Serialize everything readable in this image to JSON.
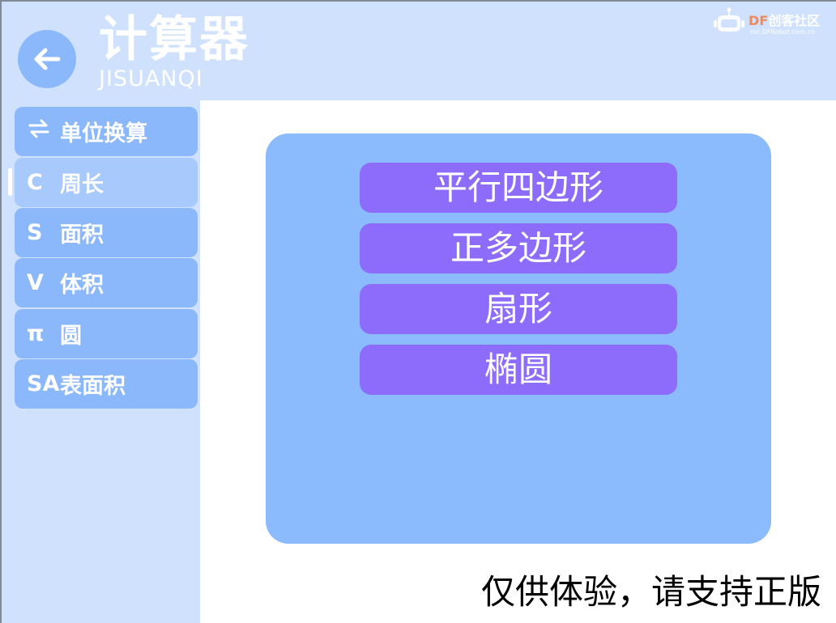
{
  "header": {
    "title": "计算器",
    "subtitle": "JISUANQI",
    "back_icon": "arrow-left-icon"
  },
  "logo": {
    "name_prefix": "DF",
    "name_suffix": "创客社区",
    "url": "mc.DFRobot.com.cn",
    "accent_color": "#f08a5d"
  },
  "sidebar": {
    "items": [
      {
        "symbol": "⇄",
        "label": "单位换算",
        "icon": "convert-arrows-icon"
      },
      {
        "symbol": "C",
        "label": "周长",
        "active": true
      },
      {
        "symbol": "S",
        "label": "面积"
      },
      {
        "symbol": "V",
        "label": "体积"
      },
      {
        "symbol": "π",
        "label": "圆"
      },
      {
        "symbol": "SA",
        "label": "表面积"
      }
    ]
  },
  "main": {
    "options": [
      {
        "label": "平行四边形"
      },
      {
        "label": "正多边形"
      },
      {
        "label": "扇形"
      },
      {
        "label": "椭圆"
      }
    ]
  },
  "footer": {
    "watermark": "仅供体验，请支持正版"
  },
  "colors": {
    "header_bg": "#cfe1fd",
    "nav_bg": "#8bb8fb",
    "nav_active_bg": "#a7c9fc",
    "panel_bg": "#8bbbfc",
    "option_bg": "#8d6cfb"
  }
}
